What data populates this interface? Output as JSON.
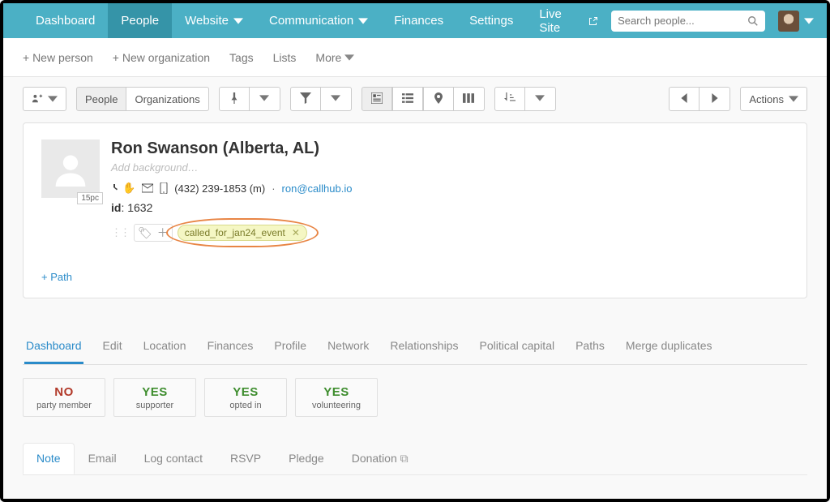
{
  "topnav": {
    "items": [
      "Dashboard",
      "People",
      "Website",
      "Communication",
      "Finances",
      "Settings",
      "Live Site"
    ],
    "active_index": 1,
    "search_placeholder": "Search people..."
  },
  "subnav": {
    "new_person": "+ New person",
    "new_org": "+ New organization",
    "tags": "Tags",
    "lists": "Lists",
    "more": "More"
  },
  "toolbar": {
    "seg_a_people": "People",
    "seg_a_orgs": "Organizations",
    "actions": "Actions"
  },
  "profile": {
    "name": "Ron Swanson (Alberta, AL)",
    "add_background": "Add background…",
    "phone": "(432) 239-1853 (m)",
    "email": "ron@callhub.io",
    "id_label": "id",
    "id_value": "1632",
    "tag": "called_for_jan24_event",
    "badge": "15pc",
    "path_link": "+ Path"
  },
  "tabs": [
    "Dashboard",
    "Edit",
    "Location",
    "Finances",
    "Profile",
    "Network",
    "Relationships",
    "Political $capital",
    "Paths",
    "Merge duplicates"
  ],
  "tabs_display": [
    "Dashboard",
    "Edit",
    "Location",
    "Finances",
    "Profile",
    "Network",
    "Relationships",
    "Political capital",
    "Paths",
    "Merge duplicates"
  ],
  "tab_active_index": 0,
  "status": [
    {
      "value": "NO",
      "kind": "no",
      "label": "party member"
    },
    {
      "value": "YES",
      "kind": "yes",
      "label": "supporter"
    },
    {
      "value": "YES",
      "kind": "yes",
      "label": "opted in"
    },
    {
      "value": "YES",
      "kind": "yes",
      "label": "volunteering"
    }
  ],
  "note_tabs": [
    "Note",
    "Email",
    "Log contact",
    "RSVP",
    "Pledge",
    "Donation"
  ],
  "note_tab_active_index": 0
}
